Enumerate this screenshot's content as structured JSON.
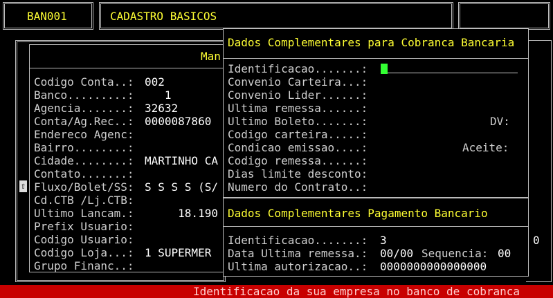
{
  "header": {
    "program_code": "BAN001",
    "screen_title": "CADASTRO BASICOS"
  },
  "main_panel": {
    "title_fragment": "Man",
    "scroll_icon": "scroll-up-icon",
    "fields": [
      {
        "label": "Codigo Conta..:",
        "value": "002"
      },
      {
        "label": "Banco.........:",
        "value": "   1"
      },
      {
        "label": "Agencia.......:",
        "value": "32632"
      },
      {
        "label": "Conta/Ag.Rec..:",
        "value": "0000087860"
      },
      {
        "label": "Endereco Agenc:",
        "value": ""
      },
      {
        "label": "Bairro........:",
        "value": ""
      },
      {
        "label": "Cidade........:",
        "value": "MARTINHO CA"
      },
      {
        "label": "Contato.......:",
        "value": ""
      },
      {
        "label": "Fluxo/Bolet/SS:",
        "value": "S S S S (S/"
      },
      {
        "label": "Cd.CTB /Lj.CTB:",
        "value": ""
      },
      {
        "label": "Ultimo Lancam.:",
        "value": "     18.190"
      },
      {
        "label": "Prefix Usuario:",
        "value": ""
      },
      {
        "label": "Codigo Usuario:",
        "value": ""
      },
      {
        "label": "Codigo Loja...:",
        "value": "1 SUPERMER"
      },
      {
        "label": "Grupo Financ..:",
        "value": ""
      }
    ],
    "right_edge_value": "0"
  },
  "cobranca_popup": {
    "title": "Dados Complementares para Cobranca Bancaria",
    "fields": [
      {
        "label": "Identificacao.......:",
        "value": ""
      },
      {
        "label": "Convenio Carteira...:",
        "value": ""
      },
      {
        "label": "Convenio Lider......:",
        "value": ""
      },
      {
        "label": "Ultima remessa......:",
        "value": ""
      },
      {
        "label": "Ultimo Boleto.......:",
        "value": ""
      },
      {
        "label": "Codigo carteira.....:",
        "value": ""
      },
      {
        "label": "Condicao emissao....:",
        "value": ""
      },
      {
        "label": "Codigo remessa......:",
        "value": ""
      },
      {
        "label": "Dias limite desconto:",
        "value": ""
      },
      {
        "label": "Numero do Contrato..:",
        "value": ""
      }
    ],
    "dv_label": "DV:",
    "aceite_label": "Aceite:"
  },
  "pagamento_popup": {
    "title": "Dados Complementares Pagamento Bancario",
    "fields": [
      {
        "label": "Identificacao.......:",
        "value": "3"
      },
      {
        "label": "Data Ultima remessa.:",
        "value": "00/00"
      },
      {
        "label": "Ultima autorizacao..:",
        "value": "0000000000000000"
      }
    ],
    "sequencia_label": "Sequencia:",
    "sequencia_value": "00"
  },
  "status_bar": {
    "message": "Identificacao da sua empresa no banco de cobranca",
    "color": "#c80000"
  }
}
